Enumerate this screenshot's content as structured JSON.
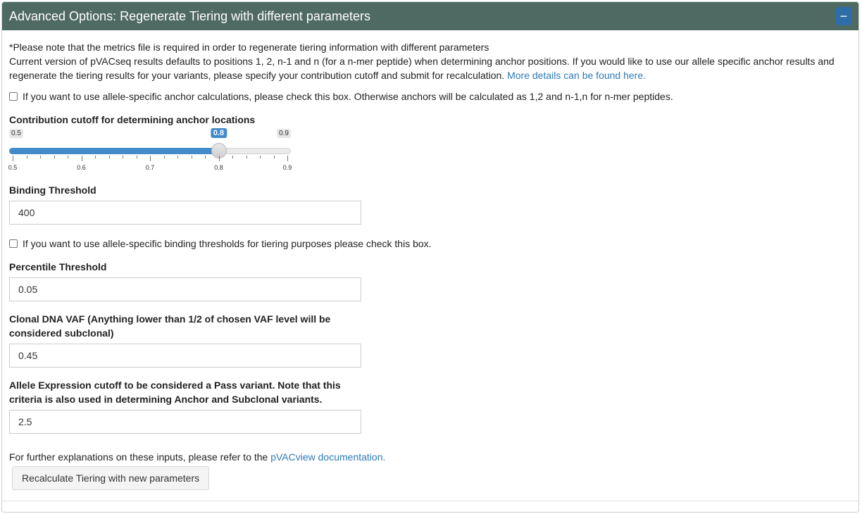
{
  "header": {
    "title": "Advanced Options: Regenerate Tiering with different parameters",
    "collapse_symbol": "−"
  },
  "note": {
    "line1": "*Please note that the metrics file is required in order to regenerate tiering information with different parameters",
    "line2": "Current version of pVACseq results defaults to positions 1, 2, n-1 and n (for a n-mer peptide) when determining anchor positions. If you would like to use our allele specific anchor results and regenerate the tiering results for your variants, please specify your contribution cutoff and submit for recalculation. ",
    "link": "More details can be found here."
  },
  "anchor_checkbox": {
    "label": "If you want to use allele-specific anchor calculations, please check this box. Otherwise anchors will be calculated as 1,2 and n-1,n for n-mer peptides.",
    "checked": false
  },
  "contribution": {
    "label": "Contribution cutoff for determining anchor locations",
    "min": 0.5,
    "max": 0.9,
    "value": 0.8,
    "min_label": "0.5",
    "max_label": "0.9",
    "value_label": "0.8",
    "tick_labels": [
      "0.5",
      "0.6",
      "0.7",
      "0.8",
      "0.9"
    ],
    "accent": "#428bca"
  },
  "binding": {
    "label": "Binding Threshold",
    "value": "400"
  },
  "binding_checkbox": {
    "label": "If you want to use allele-specific binding thresholds for tiering purposes please check this box.",
    "checked": false
  },
  "percentile": {
    "label": "Percentile Threshold",
    "value": "0.05"
  },
  "vaf": {
    "label_line1": "Clonal DNA VAF (Anything lower than 1/2 of chosen VAF level will be",
    "label_line2": "considered subclonal)",
    "value": "0.45"
  },
  "expression": {
    "label_line1": "Allele Expression cutoff to be considered a Pass variant. Note that this",
    "label_line2": "criteria is also used in determining Anchor and Subclonal variants.",
    "value": "2.5"
  },
  "footer": {
    "text": "For further explanations on these inputs, please refer to the ",
    "link": "pVACview documentation."
  },
  "submit_button": {
    "label": "Recalculate Tiering with new parameters"
  },
  "colors": {
    "header_bg": "#4f6a62",
    "collapse_btn": "#2d6ea8",
    "link": "#2f7ab9"
  }
}
